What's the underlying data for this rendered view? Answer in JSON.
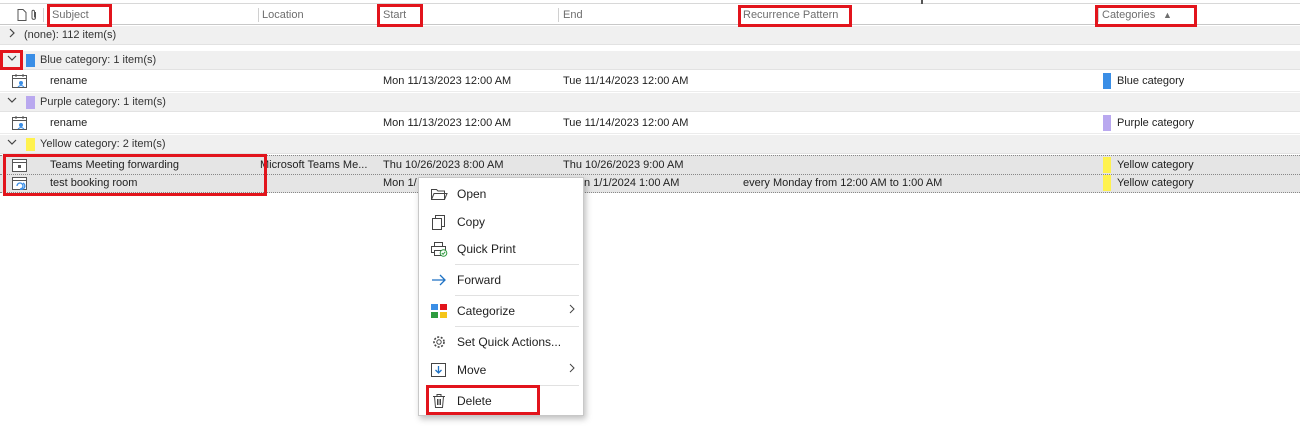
{
  "columns": {
    "subject": "Subject",
    "location": "Location",
    "start": "Start",
    "end": "End",
    "recurrence": "Recurrence Pattern",
    "categories": "Categories",
    "sort_indicator": "▲"
  },
  "groups": [
    {
      "label": "(none): 112 item(s)",
      "expanded": false
    },
    {
      "label": "Blue category: 1 item(s)",
      "expanded": true,
      "color": "#3a8ee6"
    },
    {
      "label": "Purple category: 1 item(s)",
      "expanded": true,
      "color": "#b9a8ef"
    },
    {
      "label": "Yellow category: 2 item(s)",
      "expanded": true,
      "color": "#fff24e"
    }
  ],
  "rows": [
    {
      "subject": "rename",
      "location": "",
      "start": "Mon 11/13/2023 12:00 AM",
      "end": "Tue 11/14/2023 12:00 AM",
      "recurrence": "",
      "category": "Blue category",
      "category_color": "#3a8ee6"
    },
    {
      "subject": "rename",
      "location": "",
      "start": "Mon 11/13/2023 12:00 AM",
      "end": "Tue 11/14/2023 12:00 AM",
      "recurrence": "",
      "category": "Purple category",
      "category_color": "#b9a8ef"
    },
    {
      "subject": "Teams Meeting forwarding",
      "location": "Microsoft Teams Me...",
      "start": "Thu 10/26/2023 8:00 AM",
      "end": "Thu 10/26/2023 9:00 AM",
      "recurrence": "",
      "category": "Yellow category",
      "category_color": "#fff24e"
    },
    {
      "subject": "test booking room",
      "location": "",
      "start": "Mon 1/",
      "end": "n 1/1/2024 1:00 AM",
      "recurrence": "every Monday from 12:00 AM to 1:00 AM",
      "category": "Yellow category",
      "category_color": "#fff24e"
    }
  ],
  "context_menu": {
    "open": "Open",
    "copy": "Copy",
    "quick_print": "Quick Print",
    "forward": "Forward",
    "categorize": "Categorize",
    "set_quick_actions": "Set Quick Actions...",
    "move": "Move",
    "delete": "Delete"
  },
  "colors": {
    "highlight": "#e2141c",
    "accent_blue": "#3a8ee6"
  }
}
